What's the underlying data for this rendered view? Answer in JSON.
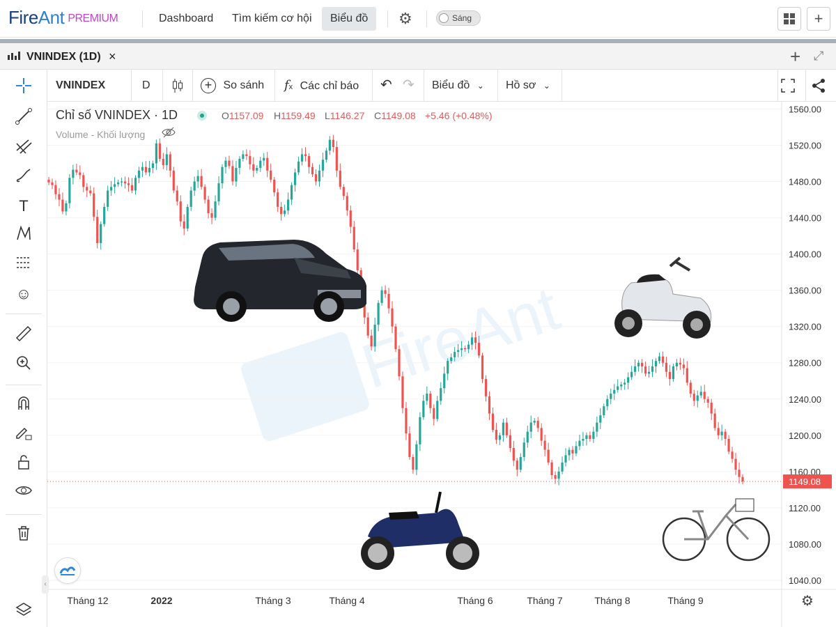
{
  "nav": {
    "logo_fire": "Fire",
    "logo_ant": "Ant",
    "logo_premium": "PREMIUM",
    "items": [
      "Dashboard",
      "Tìm kiếm cơ hội",
      "Biểu đồ"
    ],
    "active": "Biểu đồ",
    "theme_toggle": "Sáng"
  },
  "tab": {
    "title": "VNINDEX (1D)",
    "close": "×"
  },
  "toolbar": {
    "symbol": "VNINDEX",
    "interval": "D",
    "compare": "So sánh",
    "indicators": "Các chỉ báo",
    "chart_type": "Biểu đồ",
    "profile": "Hồ sơ"
  },
  "legend": {
    "title": "Chỉ số VNINDEX · 1D",
    "o_key": "O",
    "o": "1157.09",
    "h_key": "H",
    "h": "1159.49",
    "l_key": "L",
    "l": "1146.27",
    "c_key": "C",
    "c": "1149.08",
    "change": "+5.46 (+0.48%)",
    "volume_label": "Volume - Khối lượng"
  },
  "watermark": "FireAnt",
  "colors": {
    "up": "#26a69a",
    "down": "#ef5350",
    "last_price_bg": "#ef5350",
    "accent": "#2f86d6"
  },
  "chart_data": {
    "type": "candlestick",
    "title": "Chỉ số VNINDEX · 1D",
    "y_ticks": [
      1560,
      1520,
      1480,
      1440,
      1400,
      1360,
      1320,
      1280,
      1240,
      1200,
      1160,
      1120,
      1080,
      1040
    ],
    "ylim": [
      1030,
      1568
    ],
    "x_ticks": [
      "Tháng 12",
      "2022",
      "Tháng 3",
      "Tháng 4",
      "Tháng 6",
      "Tháng 7",
      "Tháng 8",
      "Tháng 9"
    ],
    "last_price": 1149.08,
    "close_series": [
      1479,
      1476,
      1466,
      1460,
      1447,
      1456,
      1484,
      1493,
      1490,
      1487,
      1474,
      1470,
      1467,
      1441,
      1412,
      1433,
      1452,
      1470,
      1474,
      1477,
      1479,
      1480,
      1478,
      1476,
      1470,
      1484,
      1492,
      1496,
      1490,
      1495,
      1500,
      1522,
      1505,
      1498,
      1510,
      1492,
      1470,
      1458,
      1436,
      1428,
      1452,
      1470,
      1480,
      1486,
      1474,
      1460,
      1445,
      1440,
      1458,
      1478,
      1496,
      1503,
      1497,
      1480,
      1495,
      1505,
      1510,
      1508,
      1499,
      1492,
      1495,
      1503,
      1506,
      1492,
      1482,
      1468,
      1452,
      1444,
      1448,
      1460,
      1476,
      1490,
      1502,
      1510,
      1508,
      1496,
      1488,
      1480,
      1492,
      1504,
      1514,
      1526,
      1518,
      1492,
      1474,
      1464,
      1448,
      1430,
      1405,
      1382,
      1357,
      1330,
      1310,
      1298,
      1322,
      1346,
      1360,
      1356,
      1340,
      1320,
      1295,
      1265,
      1230,
      1202,
      1176,
      1162,
      1190,
      1220,
      1238,
      1246,
      1230,
      1218,
      1238,
      1252,
      1268,
      1282,
      1286,
      1292,
      1294,
      1296,
      1295,
      1300,
      1308,
      1302,
      1288,
      1262,
      1243,
      1224,
      1206,
      1195,
      1200,
      1214,
      1200,
      1186,
      1172,
      1162,
      1176,
      1192,
      1204,
      1214,
      1216,
      1208,
      1194,
      1184,
      1170,
      1156,
      1152,
      1160,
      1170,
      1178,
      1184,
      1180,
      1188,
      1194,
      1196,
      1200,
      1196,
      1204,
      1214,
      1222,
      1232,
      1240,
      1246,
      1250,
      1254,
      1256,
      1258,
      1264,
      1270,
      1276,
      1280,
      1276,
      1268,
      1270,
      1276,
      1282,
      1287,
      1280,
      1270,
      1262,
      1276,
      1280,
      1278,
      1274,
      1258,
      1246,
      1238,
      1244,
      1248,
      1240,
      1236,
      1224,
      1208,
      1200,
      1204,
      1196,
      1182,
      1174,
      1162,
      1154,
      1149
    ]
  }
}
